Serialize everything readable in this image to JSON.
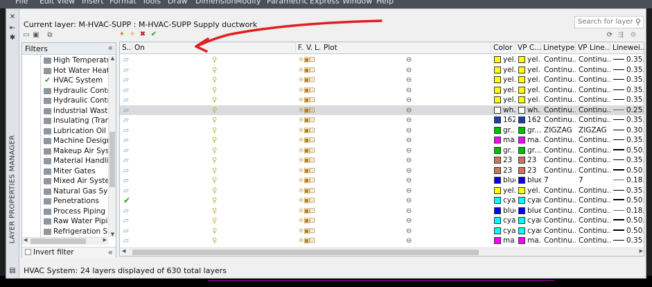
{
  "menubar": {
    "items": [
      "File",
      "Edit",
      "View",
      "Insert",
      "Format",
      "Tools",
      "Draw",
      "Dimension",
      "Modify",
      "Parametric",
      "Express",
      "Window",
      "Help"
    ]
  },
  "palette": {
    "title": "LAYER PROPERTIES MANAGER",
    "current_layer_label": "Current layer: M-HVAC-SUPP : M-HVAC-SUPP   Supply ductwork",
    "search_placeholder": "Search for layer"
  },
  "filters": {
    "title": "Filters",
    "items": [
      {
        "label": "High Temperature",
        "icon": "folder-icon"
      },
      {
        "label": "Hot Water Heating",
        "icon": "folder-icon"
      },
      {
        "label": "HVAC System",
        "icon": "check-icon"
      },
      {
        "label": "Hydraulic Control :",
        "icon": "folder-icon"
      },
      {
        "label": "Hydraulic Control :",
        "icon": "folder-icon"
      },
      {
        "label": "Industrial Waste Pi",
        "icon": "folder-icon"
      },
      {
        "label": "Insulating (Transfo",
        "icon": "folder-icon"
      },
      {
        "label": "Lubrication Oil",
        "icon": "folder-icon"
      },
      {
        "label": "Machine Design",
        "icon": "folder-icon"
      },
      {
        "label": "Makeup Air System",
        "icon": "folder-icon"
      },
      {
        "label": "Material Handling",
        "icon": "folder-icon"
      },
      {
        "label": "Miter Gates",
        "icon": "folder-icon"
      },
      {
        "label": "Mixed Air System",
        "icon": "folder-icon"
      },
      {
        "label": "Natural Gas Systen",
        "icon": "folder-icon"
      },
      {
        "label": "Penetrations",
        "icon": "folder-icon"
      },
      {
        "label": "Process Piping",
        "icon": "folder-icon"
      },
      {
        "label": "Raw Water Piping",
        "icon": "folder-icon"
      },
      {
        "label": "Refrigeration Syster",
        "icon": "folder-icon"
      }
    ],
    "invert_filter_label": "Invert filter"
  },
  "grid": {
    "headers": {
      "status": "S..",
      "name": "On",
      "freeze": "F..",
      "vpfreeze": "V..",
      "lock": "L..",
      "plot": "Plot",
      "color": "Color",
      "vpcolor": "VP C...",
      "linetype": "Linetype",
      "vplinetype": "VP Line...",
      "lineweight": "Linewei..."
    },
    "rows": [
      {
        "status": "layer",
        "color_name": "yel...",
        "color_hex": "#ffff00",
        "vp_name": "yel...",
        "vp_hex": "#ffff00",
        "linetype": "Continu...",
        "vplinetype": "Continu...",
        "lineweight": "0.35...",
        "lw_style": "thick",
        "selected": false
      },
      {
        "status": "layer",
        "color_name": "yel...",
        "color_hex": "#ffff00",
        "vp_name": "yel...",
        "vp_hex": "#ffff00",
        "linetype": "Continu...",
        "vplinetype": "Continu...",
        "lineweight": "0.35...",
        "lw_style": "thick",
        "selected": false
      },
      {
        "status": "layer",
        "color_name": "yel...",
        "color_hex": "#ffff00",
        "vp_name": "yel...",
        "vp_hex": "#ffff00",
        "linetype": "Continu...",
        "vplinetype": "Continu...",
        "lineweight": "0.35...",
        "lw_style": "thick",
        "selected": false
      },
      {
        "status": "layer",
        "color_name": "yel...",
        "color_hex": "#ffff00",
        "vp_name": "yel...",
        "vp_hex": "#ffff00",
        "linetype": "Continu...",
        "vplinetype": "Continu...",
        "lineweight": "0.35...",
        "lw_style": "thick",
        "selected": false
      },
      {
        "status": "layer",
        "color_name": "yel...",
        "color_hex": "#ffff00",
        "vp_name": "yel...",
        "vp_hex": "#ffff00",
        "linetype": "Continu...",
        "vplinetype": "Continu...",
        "lineweight": "0.35...",
        "lw_style": "thick",
        "selected": false
      },
      {
        "status": "layer",
        "color_name": "wh...",
        "color_hex": "#ffffff",
        "vp_name": "wh...",
        "vp_hex": "#ffffff",
        "linetype": "Continu...",
        "vplinetype": "Continu...",
        "lineweight": "0.25...",
        "lw_style": "thin",
        "selected": true
      },
      {
        "status": "layer",
        "color_name": "162",
        "color_hex": "#1a3fa8",
        "vp_name": "162",
        "vp_hex": "#1a3fa8",
        "linetype": "Continu...",
        "vplinetype": "Continu...",
        "lineweight": "0.35...",
        "lw_style": "thick",
        "selected": false
      },
      {
        "status": "layer",
        "color_name": "gr...",
        "color_hex": "#00c000",
        "vp_name": "gr...",
        "vp_hex": "#00c000",
        "linetype": "ZIGZAG",
        "vplinetype": "ZIGZAG",
        "lineweight": "0.30...",
        "lw_style": "thick",
        "selected": false
      },
      {
        "status": "layer",
        "color_name": "ma...",
        "color_hex": "#ff00ff",
        "vp_name": "ma...",
        "vp_hex": "#ff00ff",
        "linetype": "Continu...",
        "vplinetype": "Continu...",
        "lineweight": "0.35...",
        "lw_style": "thick",
        "selected": false
      },
      {
        "status": "layer",
        "color_name": "gr...",
        "color_hex": "#00c000",
        "vp_name": "gr...",
        "vp_hex": "#00c000",
        "linetype": "Continu...",
        "vplinetype": "Continu...",
        "lineweight": "0.50...",
        "lw_style": "med",
        "selected": false
      },
      {
        "status": "layer",
        "color_name": "23",
        "color_hex": "#c87860",
        "vp_name": "23",
        "vp_hex": "#c87860",
        "linetype": "Continu...",
        "vplinetype": "Continu...",
        "lineweight": "0.35...",
        "lw_style": "thick",
        "selected": false
      },
      {
        "status": "layer",
        "color_name": "23",
        "color_hex": "#c87860",
        "vp_name": "23",
        "vp_hex": "#c87860",
        "linetype": "Continu...",
        "vplinetype": "Continu...",
        "lineweight": "0.50...",
        "lw_style": "med",
        "selected": false
      },
      {
        "status": "layer",
        "color_name": "blue",
        "color_hex": "#0000ff",
        "vp_name": "blue",
        "vp_hex": "#0000ff",
        "linetype": "7",
        "vplinetype": "7",
        "lineweight": "0.18...",
        "lw_style": "thin",
        "selected": false
      },
      {
        "status": "layer",
        "color_name": "yel...",
        "color_hex": "#ffff00",
        "vp_name": "yel...",
        "vp_hex": "#ffff00",
        "linetype": "Continu...",
        "vplinetype": "Continu...",
        "lineweight": "0.35...",
        "lw_style": "thick",
        "selected": false
      },
      {
        "status": "check",
        "color_name": "cyan",
        "color_hex": "#00ffff",
        "vp_name": "cyan",
        "vp_hex": "#00ffff",
        "linetype": "Continu...",
        "vplinetype": "Continu...",
        "lineweight": "0.50...",
        "lw_style": "med",
        "selected": false
      },
      {
        "status": "layer",
        "color_name": "blue",
        "color_hex": "#0000ff",
        "vp_name": "blue",
        "vp_hex": "#0000ff",
        "linetype": "Continu...",
        "vplinetype": "Continu...",
        "lineweight": "0.18...",
        "lw_style": "thin",
        "selected": false
      },
      {
        "status": "layer",
        "color_name": "cyan",
        "color_hex": "#00ffff",
        "vp_name": "cyan",
        "vp_hex": "#00ffff",
        "linetype": "Continu...",
        "vplinetype": "Continu...",
        "lineweight": "0.50...",
        "lw_style": "med",
        "selected": false
      },
      {
        "status": "layer",
        "color_name": "cyan",
        "color_hex": "#00ffff",
        "vp_name": "cyan",
        "vp_hex": "#00ffff",
        "linetype": "Continu...",
        "vplinetype": "Continu...",
        "lineweight": "0.50...",
        "lw_style": "med",
        "selected": false
      },
      {
        "status": "layer",
        "color_name": "ma...",
        "color_hex": "#ff00ff",
        "vp_name": "ma...",
        "vp_hex": "#ff00ff",
        "linetype": "Continu...",
        "vplinetype": "Continu...",
        "lineweight": "0.35...",
        "lw_style": "thick",
        "selected": false
      }
    ]
  },
  "status_bar": {
    "text": "HVAC System: 24 layers displayed of 630 total layers"
  },
  "colors": {
    "annotation_red": "#e02020",
    "selected_row": "#dadbde"
  }
}
